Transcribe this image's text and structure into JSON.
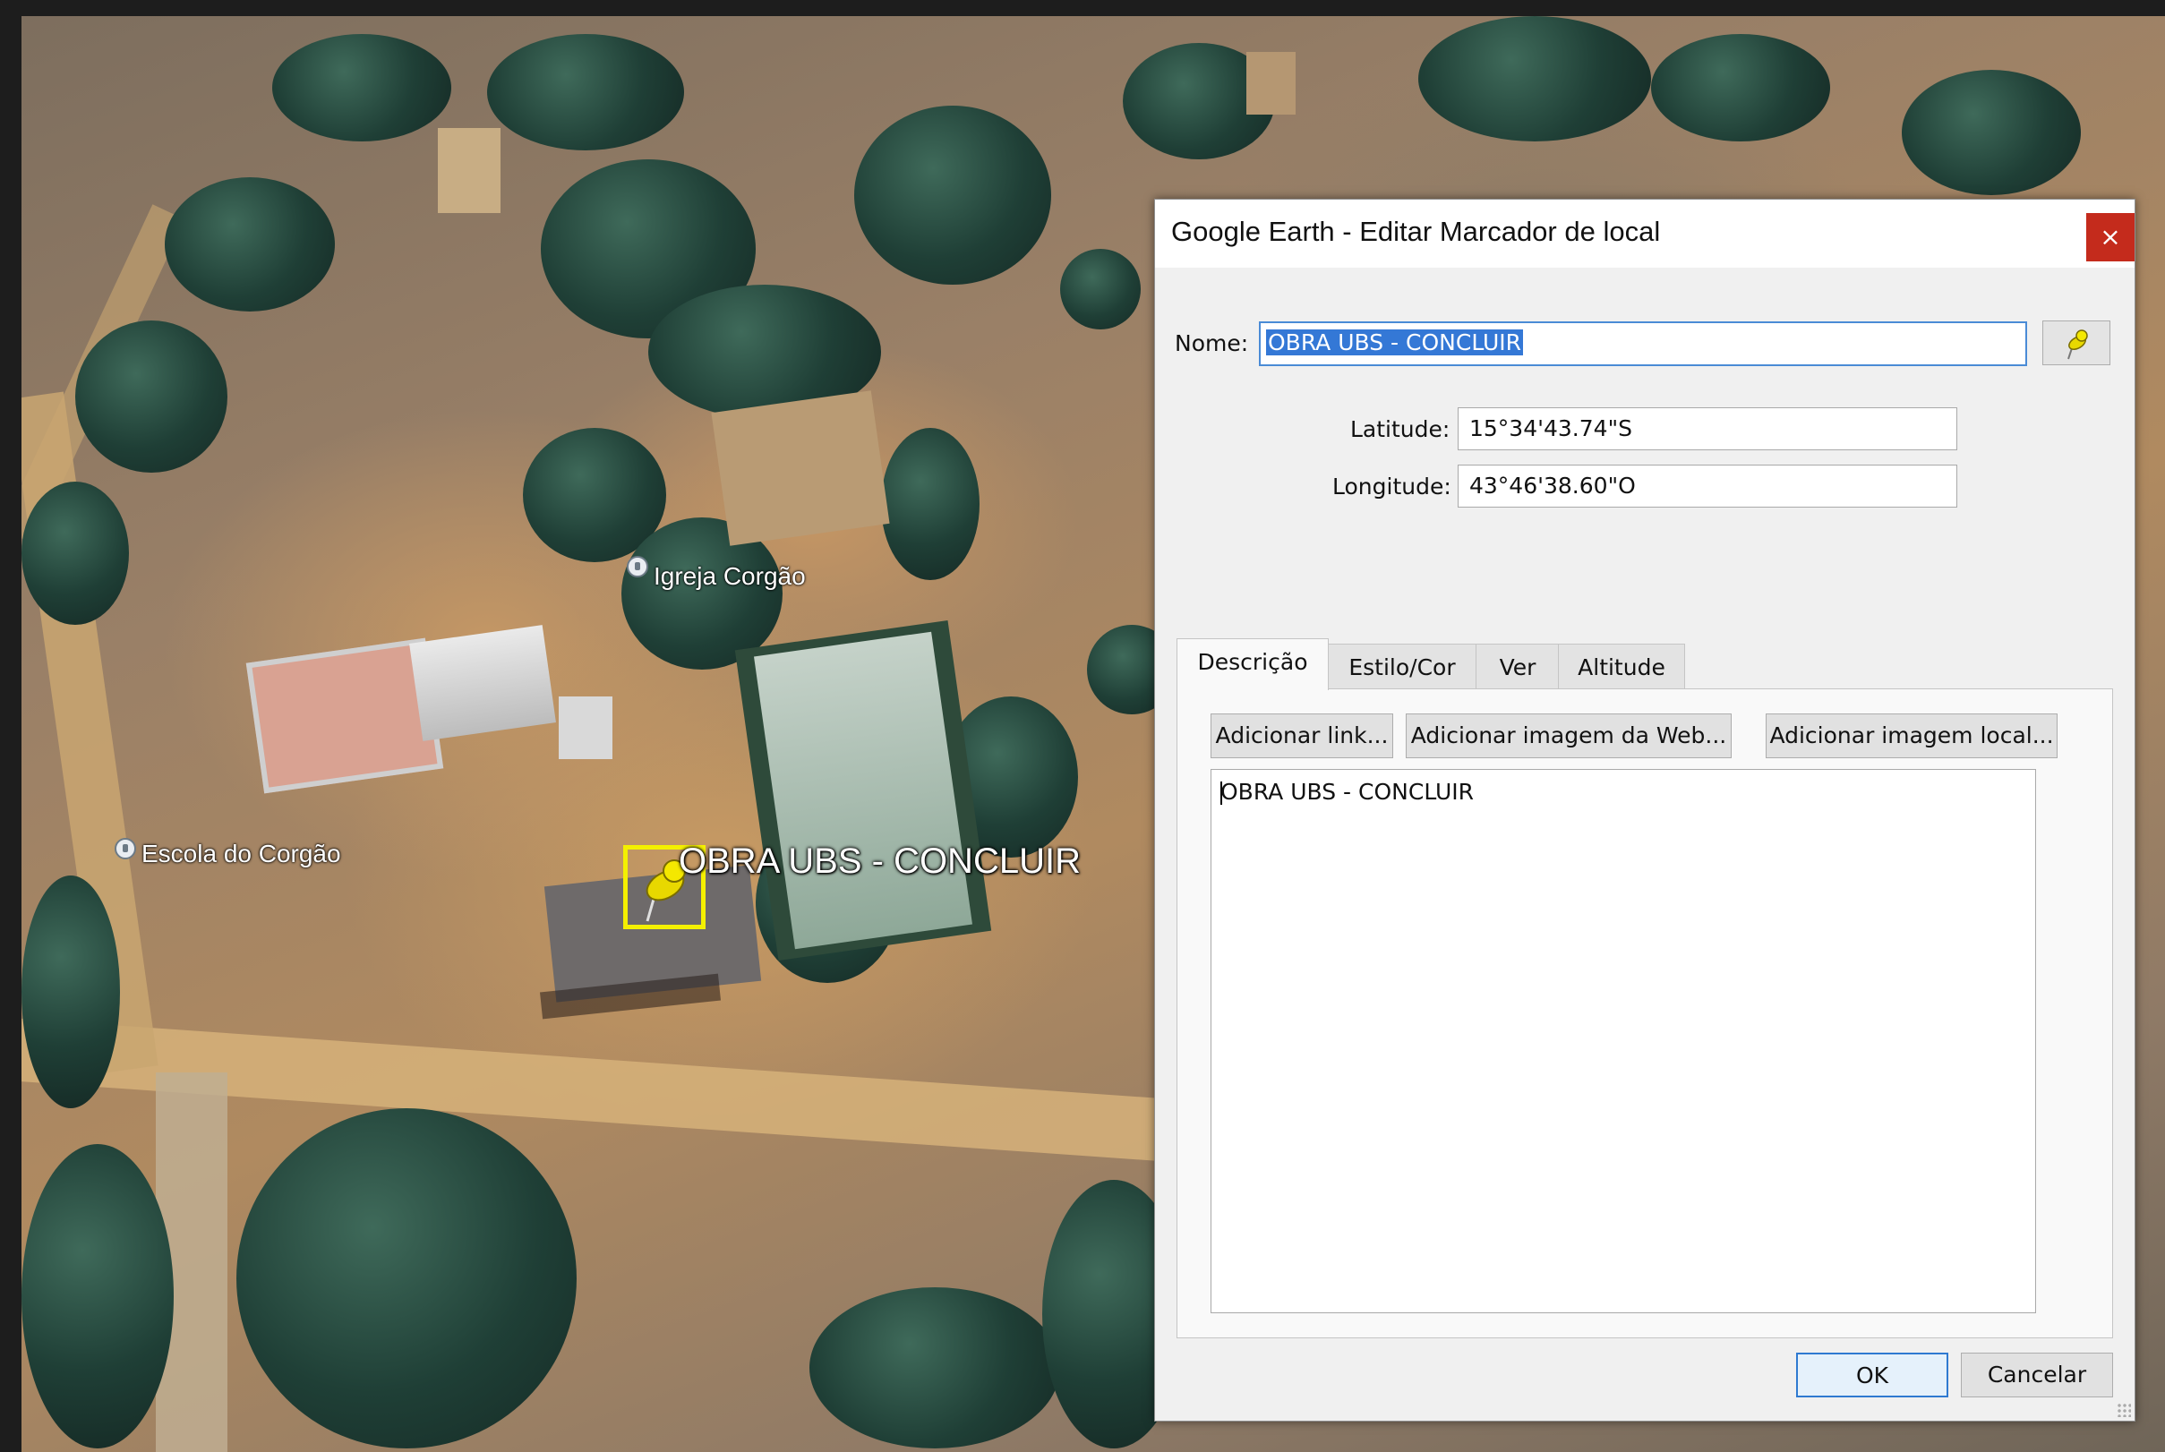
{
  "map": {
    "poi_church": "Igreja Corgão",
    "poi_school": "Escola do Corgão",
    "placemark_label": "OBRA UBS - CONCLUIR",
    "placemark_icon": "pushpin-icon",
    "placemark_color": "#f4f000"
  },
  "dialog": {
    "title": "Google Earth - Editar Marcador de local",
    "close": "×",
    "name_label": "Nome:",
    "name_value": "OBRA UBS - CONCLUIR",
    "latitude_label": "Latitude:",
    "latitude_value": "15°34'43.74\"S",
    "longitude_label": "Longitude:",
    "longitude_value": "43°46'38.60\"O",
    "tabs": [
      {
        "label": "Descrição",
        "active": true
      },
      {
        "label": "Estilo/Cor",
        "active": false
      },
      {
        "label": "Ver",
        "active": false
      },
      {
        "label": "Altitude",
        "active": false
      }
    ],
    "add_link": "Adicionar link...",
    "add_web_image": "Adicionar imagem da Web...",
    "add_local_image": "Adicionar imagem local...",
    "description": "OBRA UBS - CONCLUIR",
    "ok": "OK",
    "cancel": "Cancelar",
    "close_color": "#c42b1c",
    "selection_color": "#3478d6"
  }
}
